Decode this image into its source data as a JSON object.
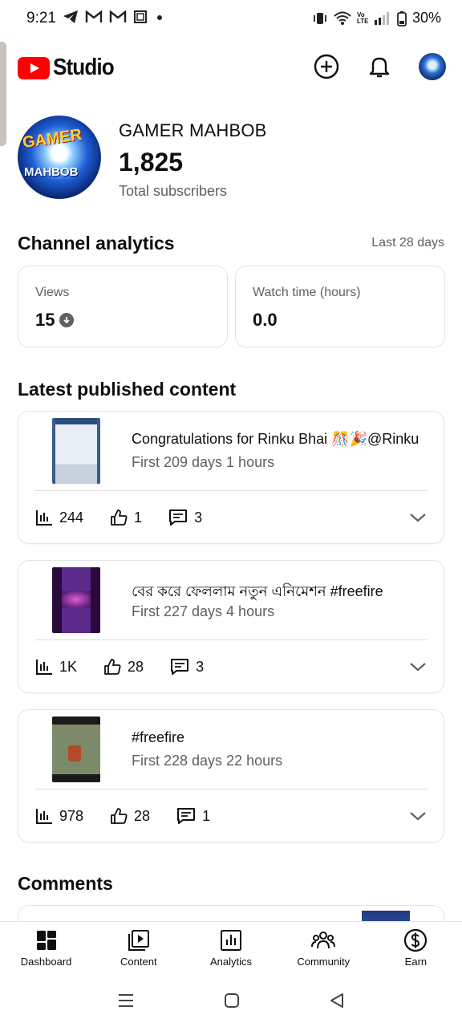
{
  "status_bar": {
    "time": "9:21",
    "left_icons": [
      "telegram-icon",
      "gmail-icon",
      "gmail-icon",
      "screenshot-icon",
      "dot-icon"
    ],
    "right_icons": [
      "vibrate-icon",
      "wifi-icon",
      "volte-icon",
      "signal-icon",
      "battery-icon"
    ],
    "volte_text": "Vo LTE",
    "battery": "30%"
  },
  "app_bar": {
    "logo_text": "Studio",
    "icons": [
      "create-icon",
      "notifications-icon",
      "account-avatar"
    ]
  },
  "channel": {
    "avatar_text_top": "GAMER",
    "avatar_text_bottom": "MAHBOB",
    "name": "GAMER MAHBOB",
    "subscribers": "1,825",
    "subscribers_label": "Total subscribers"
  },
  "analytics": {
    "title": "Channel analytics",
    "period": "Last 28 days",
    "views_label": "Views",
    "views_value": "15",
    "watch_label": "Watch time (hours)",
    "watch_value": "0.0"
  },
  "latest": {
    "title": "Latest published content",
    "items": [
      {
        "title": "Congratulations for Rinku Bhai 🎊🎉@Rinku",
        "age": "First 209 days 1 hours",
        "views": "244",
        "likes": "1",
        "comments": "3"
      },
      {
        "title": "বের করে ফেললাম নতুন এনিমেশন #freefire",
        "age": "First 227 days 4 hours",
        "views": "1K",
        "likes": "28",
        "comments": "3"
      },
      {
        "title": "#freefire",
        "age": "First 228 days 22 hours",
        "views": "978",
        "likes": "28",
        "comments": "1"
      }
    ]
  },
  "comments": {
    "title": "Comments"
  },
  "bottom_nav": [
    {
      "label": "Dashboard",
      "icon": "dashboard-icon"
    },
    {
      "label": "Content",
      "icon": "content-icon"
    },
    {
      "label": "Analytics",
      "icon": "analytics-icon"
    },
    {
      "label": "Community",
      "icon": "community-icon"
    },
    {
      "label": "Earn",
      "icon": "earn-icon"
    }
  ],
  "system_nav": [
    "recents-icon",
    "home-icon",
    "back-icon"
  ]
}
